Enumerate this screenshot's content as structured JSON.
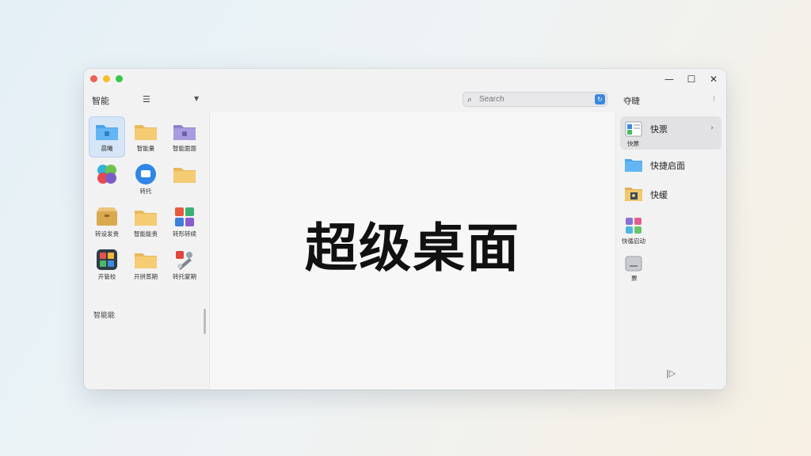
{
  "window": {
    "controls": [
      "—",
      "☐",
      "✕"
    ]
  },
  "left": {
    "header": "智能",
    "section_label": "智能能",
    "items": [
      {
        "label": "晨曦",
        "icon": "blue-folder-icon",
        "selected": true
      },
      {
        "label": "智能量",
        "icon": "folder-icon"
      },
      {
        "label": "智能面面",
        "icon": "purple-folder-icon"
      },
      {
        "label": "",
        "icon": "colorful-app-icon"
      },
      {
        "label": "转托",
        "icon": "blue-circle-app-icon"
      },
      {
        "label": "",
        "icon": "folder-icon"
      },
      {
        "label": "转设发责",
        "icon": "archive-box-icon"
      },
      {
        "label": "智能能责",
        "icon": "folder-icon"
      },
      {
        "label": "转形转续",
        "icon": "puzzle-app-icon"
      },
      {
        "label": "开管校",
        "icon": "grid-app-icon"
      },
      {
        "label": "开拼蒸期",
        "icon": "folder-icon"
      },
      {
        "label": "转托蒙期",
        "icon": "tools-app-icon"
      }
    ]
  },
  "search": {
    "placeholder": "Search"
  },
  "main": {
    "title": "超级桌面"
  },
  "right": {
    "header": "夺睫",
    "more": "⁝",
    "items": [
      {
        "label": "快票",
        "sub": "快票",
        "icon": "app-window-icon",
        "selected": true
      },
      {
        "label": "快捷启面",
        "sub": "",
        "icon": "blue-folder-icon"
      },
      {
        "label": "快缓",
        "sub": "",
        "icon": "photo-folder-icon"
      },
      {
        "label": "",
        "sub": "快循启动",
        "icon": "colorful-grid-icon"
      },
      {
        "label": "",
        "sub": "票",
        "icon": "drive-icon"
      }
    ]
  },
  "collapse_glyph": "|▷"
}
